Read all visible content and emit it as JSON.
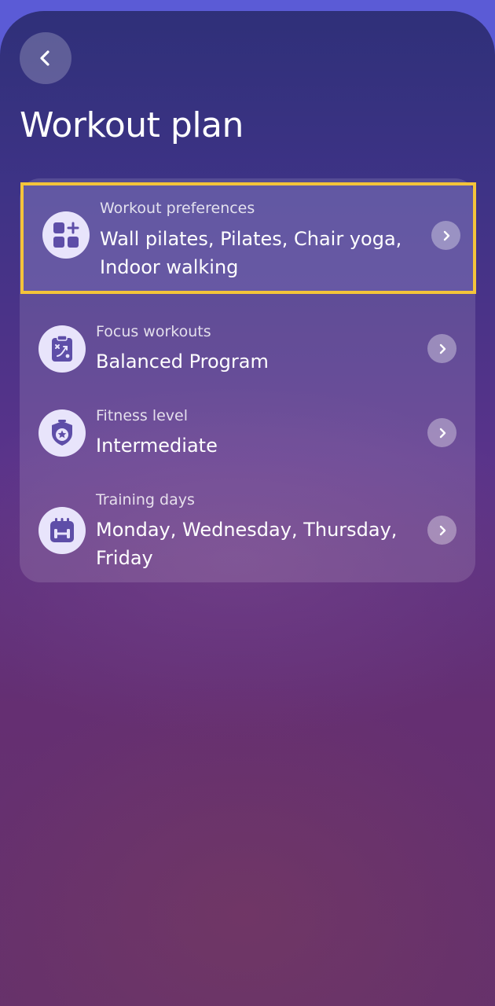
{
  "header": {
    "back_icon": "chevron-left-icon",
    "title": "Workout plan"
  },
  "plan": {
    "items": [
      {
        "label": "Workout preferences",
        "value": "Wall pilates, Pilates, Chair yoga, Indoor walking",
        "icon": "grid-plus-icon",
        "highlighted": true
      },
      {
        "label": "Focus workouts",
        "value": "Balanced Program",
        "icon": "clipboard-strategy-icon",
        "highlighted": false
      },
      {
        "label": "Fitness level",
        "value": "Intermediate",
        "icon": "shield-star-icon",
        "highlighted": false
      },
      {
        "label": "Training days",
        "value": "Monday, Wednesday, Thursday, Friday",
        "icon": "calendar-dumbbell-icon",
        "highlighted": false
      }
    ]
  },
  "colors": {
    "highlight_border": "#f4c43a",
    "icon_fill": "#5e4ea8",
    "icon_background": "#e8e4fb",
    "top_accent": "#5b5bd6"
  }
}
